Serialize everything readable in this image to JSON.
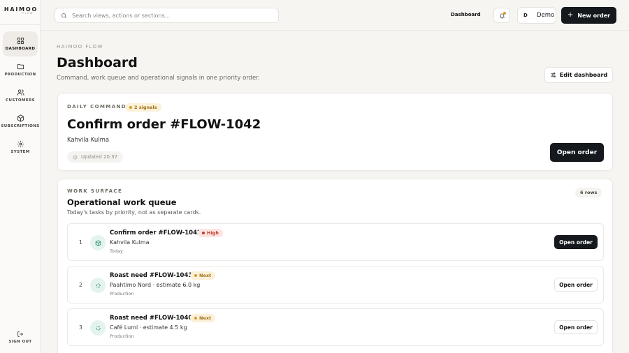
{
  "brand": {
    "name": "HAIMOO",
    "sub": "FLOW"
  },
  "sidebar": {
    "items": [
      {
        "label": "DASHBOARD",
        "icon": "grid-icon",
        "active": true
      },
      {
        "label": "PRODUCTION",
        "icon": "folder-icon"
      },
      {
        "label": "CUSTOMERS",
        "icon": "users-icon"
      },
      {
        "label": "SUBSCRIPTIONS",
        "icon": "box-icon"
      },
      {
        "label": "SYSTEM",
        "icon": "gear-icon"
      }
    ],
    "signout": "SIGN OUT"
  },
  "topbar": {
    "search_placeholder": "Search views, actions or sections...",
    "current_view": "Dashboard",
    "user_initial": "D",
    "user_name": "Demo",
    "new_order": "New order"
  },
  "header": {
    "eyebrow": "HAIMOO FLOW",
    "title": "Dashboard",
    "subtitle": "Command, work queue and operational signals in one priority order.",
    "edit_button": "Edit dashboard"
  },
  "command": {
    "eyebrow": "DAILY COMMAND",
    "badge": "2 signals",
    "title": "Confirm order #FLOW-1042",
    "customer": "Kahvila Kulma",
    "updated": "Updated 20.37",
    "button": "Open order"
  },
  "queue": {
    "eyebrow": "WORK SURFACE",
    "title": "Operational work queue",
    "subtitle": "Today's tasks by priority, not as separate cards.",
    "rows_count": "6 rows",
    "rows": [
      {
        "num": "1",
        "title": "Confirm order #FLOW-1042",
        "badge": "High",
        "desc": "Kahvila Kulma",
        "meta": "Today",
        "button": "Open order"
      },
      {
        "num": "2",
        "title": "Roast need #FLOW-1041",
        "badge": "Next",
        "desc": "Paahtimo Nord · estimate 6.0 kg",
        "meta": "Production",
        "button": "Open order"
      },
      {
        "num": "3",
        "title": "Roast need #FLOW-1040",
        "badge": "Next",
        "desc": "Café Lumi · estimate 4.5 kg",
        "meta": "Production",
        "button": "Open order"
      }
    ]
  },
  "colors": {
    "accent_dark": "#15191d",
    "high_badge_bg": "#fde4e1",
    "high_badge_text": "#c0392b",
    "next_badge_bg": "#fbf1d8",
    "next_badge_text": "#a1701a",
    "icon_green": "#1d8a64"
  }
}
